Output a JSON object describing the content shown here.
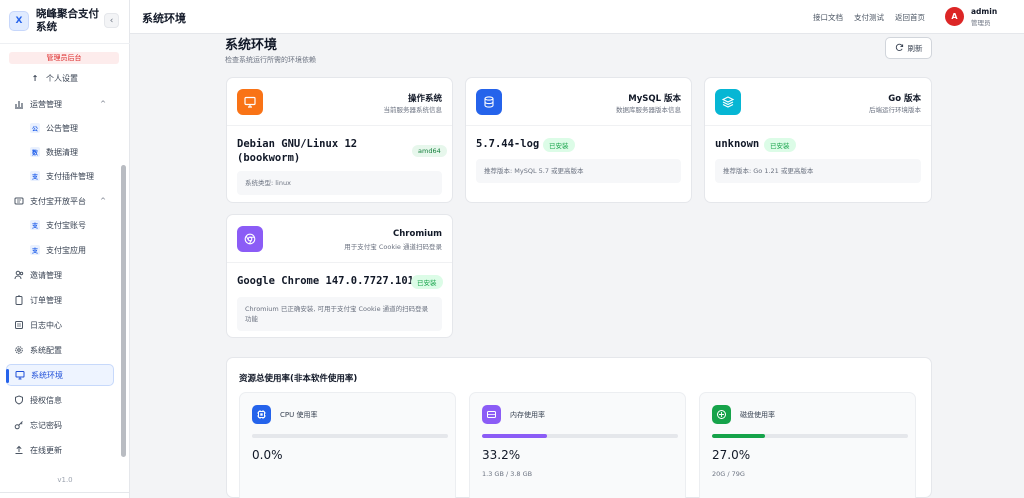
{
  "app": {
    "logo_letter": "X",
    "name": "晓峰聚合支付系统",
    "collapse_icon": "chevron-left-icon",
    "admin_label": "管理员后台",
    "version": "v1.0"
  },
  "sidebar": {
    "items": [
      {
        "label": "个人设置",
        "icon": "person-icon",
        "sub": false
      },
      {
        "label": "运营管理",
        "icon": "chart-icon",
        "sub": false,
        "expanded": true
      },
      {
        "label": "公告管理",
        "icon_text": "公",
        "sub": true
      },
      {
        "label": "数据清理",
        "icon_text": "数",
        "sub": true
      },
      {
        "label": "支付插件管理",
        "icon_text": "支",
        "sub": true
      },
      {
        "label": "支付宝开放平台",
        "icon": "card-icon",
        "sub": false,
        "expanded": true
      },
      {
        "label": "支付宝账号",
        "icon_text": "支",
        "sub": true
      },
      {
        "label": "支付宝应用",
        "icon_text": "支",
        "sub": true
      },
      {
        "label": "邀请管理",
        "icon": "users-icon",
        "sub": false
      },
      {
        "label": "订单管理",
        "icon": "clipboard-icon",
        "sub": false
      },
      {
        "label": "日志中心",
        "icon": "log-icon",
        "sub": false
      },
      {
        "label": "系统配置",
        "icon": "gear-icon",
        "sub": false
      },
      {
        "label": "系统环境",
        "icon": "monitor-icon",
        "sub": false,
        "active": true
      },
      {
        "label": "授权信息",
        "icon": "shield-icon",
        "sub": false
      },
      {
        "label": "忘记密码",
        "icon": "key-icon",
        "sub": false
      },
      {
        "label": "在线更新",
        "icon": "upload-icon",
        "sub": false
      }
    ]
  },
  "header": {
    "title": "系统环境",
    "links": [
      "接口文档",
      "支付测试",
      "返回首页"
    ],
    "user": {
      "avatar_letter": "A",
      "name": "admin",
      "role": "管理员"
    }
  },
  "main": {
    "title": "系统环境",
    "subtitle": "检查系统运行所需的环境依赖",
    "refresh_label": "刷新",
    "cards": [
      {
        "title": "操作系统",
        "subtitle": "当前服务器系统信息",
        "icon": "monitor-icon",
        "color": "#f97316",
        "value": "Debian GNU/Linux 12 (bookworm)",
        "badge": "amd64",
        "note": "系统类型: linux"
      },
      {
        "title": "MySQL 版本",
        "subtitle": "数据库服务器版本信息",
        "icon": "database-icon",
        "color": "#2563eb",
        "value": "5.7.44-log",
        "badge": "已安装",
        "note": "推荐版本: MySQL 5.7 或更高版本"
      },
      {
        "title": "Go 版本",
        "subtitle": "后端运行环境版本",
        "icon": "layers-icon",
        "color": "#06b6d4",
        "value": "unknown",
        "badge": "已安装",
        "note": "推荐版本: Go 1.21 或更高版本"
      },
      {
        "title": "Chromium",
        "subtitle": "用于支付宝 Cookie 通道扫码登录",
        "icon": "chrome-icon",
        "color": "#8b5cf6",
        "value": "Google Chrome 147.0.7727.101",
        "badge": "已安装",
        "note": "Chromium 已正确安装, 可用于支付宝 Cookie 通道的扫码登录功能"
      }
    ],
    "resources": {
      "title": "资源总使用率(非本软件使用率)",
      "items": [
        {
          "label": "CPU 使用率",
          "icon": "cpu-icon",
          "color": "#2563eb",
          "percent": 0.0,
          "value": "0.0%",
          "detail": ""
        },
        {
          "label": "内存使用率",
          "icon": "memory-icon",
          "color": "#8b5cf6",
          "percent": 33.2,
          "value": "33.2%",
          "detail": "1.3 GB / 3.8 GB"
        },
        {
          "label": "磁盘使用率",
          "icon": "disk-icon",
          "color": "#16a34a",
          "percent": 27.0,
          "value": "27.0%",
          "detail": "20G / 79G"
        }
      ]
    }
  }
}
